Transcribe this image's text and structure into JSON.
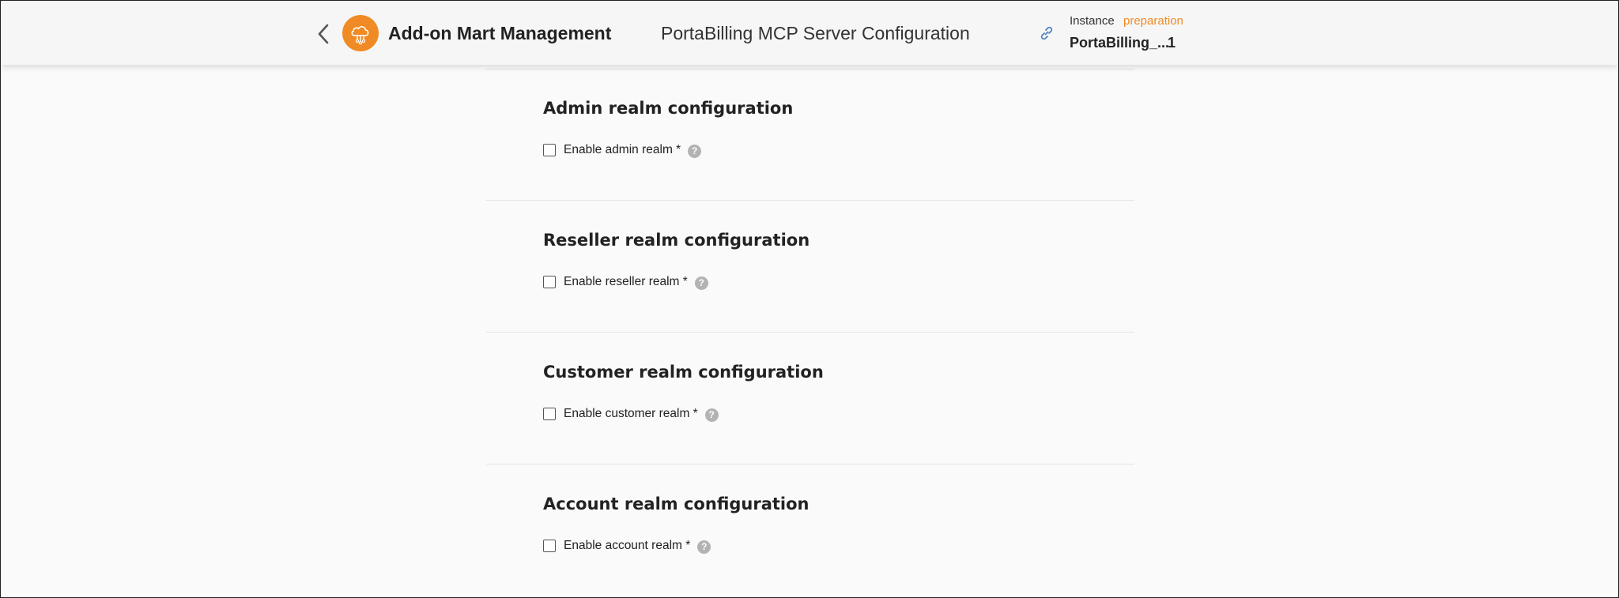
{
  "header": {
    "app_title": "Add-on Mart Management",
    "page_title": "PortaBilling MCP Server Configuration",
    "instance_label": "Instance",
    "instance_status": "preparation",
    "instance_name": "PortaBilling_...",
    "instance_count": "1",
    "icons": {
      "back": "chevron-left-icon",
      "logo": "cloud-network-icon",
      "link": "link-icon"
    }
  },
  "sections": [
    {
      "title": "Admin realm configuration",
      "checkbox_label": "Enable admin realm *",
      "checked": false
    },
    {
      "title": "Reseller realm configuration",
      "checkbox_label": "Enable reseller realm *",
      "checked": false
    },
    {
      "title": "Customer realm configuration",
      "checkbox_label": "Enable customer realm *",
      "checked": false
    },
    {
      "title": "Account realm configuration",
      "checkbox_label": "Enable account realm *",
      "checked": false
    }
  ],
  "help_glyph": "?",
  "colors": {
    "accent": "#f08a24",
    "link_icon": "#4a7fc1",
    "help_icon": "#b3b3b3"
  }
}
